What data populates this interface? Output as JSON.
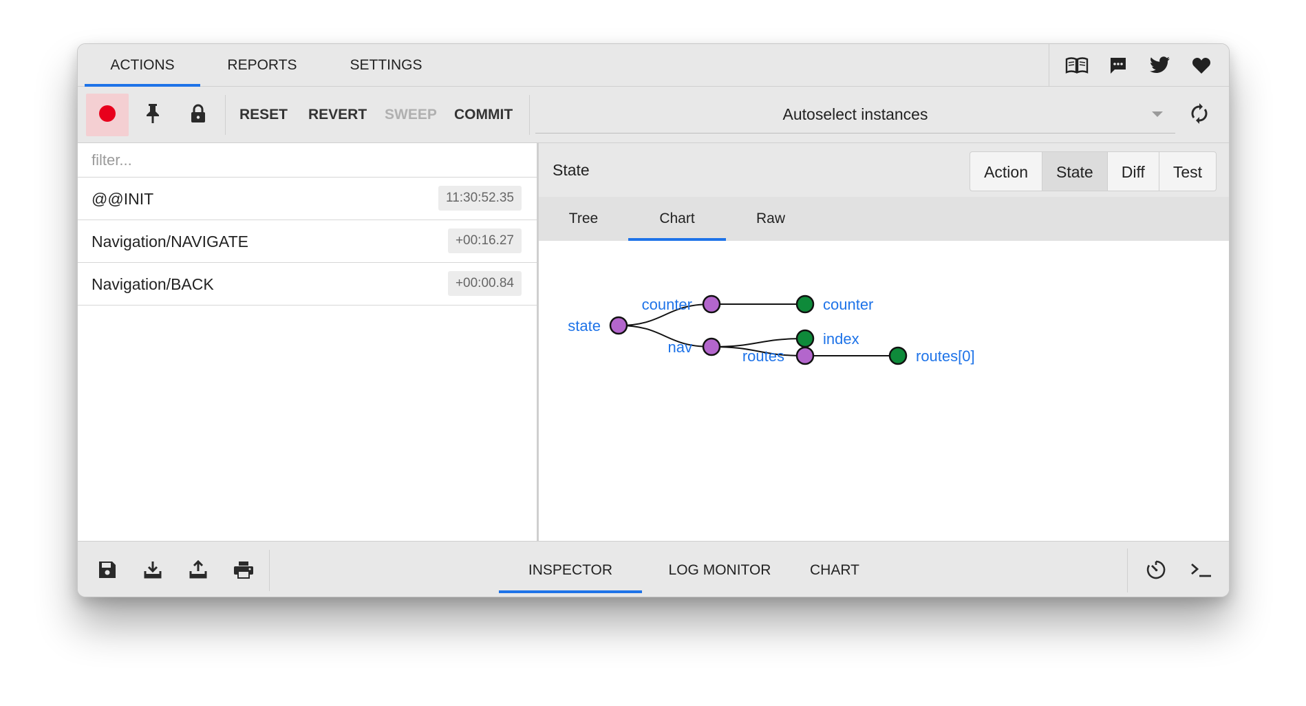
{
  "top_tabs": [
    {
      "label": "ACTIONS",
      "active": true
    },
    {
      "label": "REPORTS",
      "active": false
    },
    {
      "label": "SETTINGS",
      "active": false
    }
  ],
  "top_icons": [
    "book-icon",
    "chat-icon",
    "twitter-icon",
    "heart-icon"
  ],
  "toolbar": {
    "record_icon": "record-icon",
    "pin_icon": "pin-icon",
    "lock_icon": "lock-icon",
    "reset_label": "RESET",
    "revert_label": "REVERT",
    "sweep_label": "SWEEP",
    "commit_label": "COMMIT",
    "instances_label": "Autoselect instances",
    "sync_icon": "sync-icon"
  },
  "filter": {
    "placeholder": "filter..."
  },
  "actions": [
    {
      "name": "@@INIT",
      "time": "11:30:52.35"
    },
    {
      "name": "Navigation/NAVIGATE",
      "time": "+00:16.27"
    },
    {
      "name": "Navigation/BACK",
      "time": "+00:00.84"
    }
  ],
  "right_panel": {
    "title": "State",
    "modes": [
      {
        "label": "Action",
        "active": false
      },
      {
        "label": "State",
        "active": true
      },
      {
        "label": "Diff",
        "active": false
      },
      {
        "label": "Test",
        "active": false
      }
    ],
    "subtabs": [
      {
        "label": "Tree",
        "active": false
      },
      {
        "label": "Chart",
        "active": true
      },
      {
        "label": "Raw",
        "active": false
      }
    ]
  },
  "tree_chart": {
    "nodes": [
      {
        "id": "state",
        "label": "state",
        "kind": "branch",
        "depth": 0
      },
      {
        "id": "counter_parent",
        "label": "counter",
        "kind": "branch",
        "depth": 1
      },
      {
        "id": "nav",
        "label": "nav",
        "kind": "branch",
        "depth": 1
      },
      {
        "id": "counter_leaf",
        "label": "counter",
        "kind": "leaf",
        "depth": 2
      },
      {
        "id": "index",
        "label": "index",
        "kind": "leaf",
        "depth": 2
      },
      {
        "id": "routes",
        "label": "routes",
        "kind": "branch",
        "depth": 2
      },
      {
        "id": "routes0",
        "label": "routes[0]",
        "kind": "leaf",
        "depth": 3
      }
    ],
    "edges": [
      [
        "state",
        "counter_parent"
      ],
      [
        "state",
        "nav"
      ],
      [
        "counter_parent",
        "counter_leaf"
      ],
      [
        "nav",
        "index"
      ],
      [
        "nav",
        "routes"
      ],
      [
        "routes",
        "routes0"
      ]
    ],
    "colors": {
      "branch": "#b366cc",
      "leaf": "#0e8a3a",
      "label": "#1e73e8",
      "edge": "#111111"
    }
  },
  "bottom_icons": [
    "save-icon",
    "import-icon",
    "export-icon",
    "print-icon"
  ],
  "bottom_tabs": [
    {
      "label": "INSPECTOR",
      "active": true
    },
    {
      "label": "LOG MONITOR",
      "active": false
    },
    {
      "label": "CHART",
      "active": false
    }
  ],
  "bottom_right_icons": [
    "slider-timer-icon",
    "terminal-icon"
  ],
  "colors": {
    "accent": "#1e73e8",
    "record": "#e8001c"
  }
}
